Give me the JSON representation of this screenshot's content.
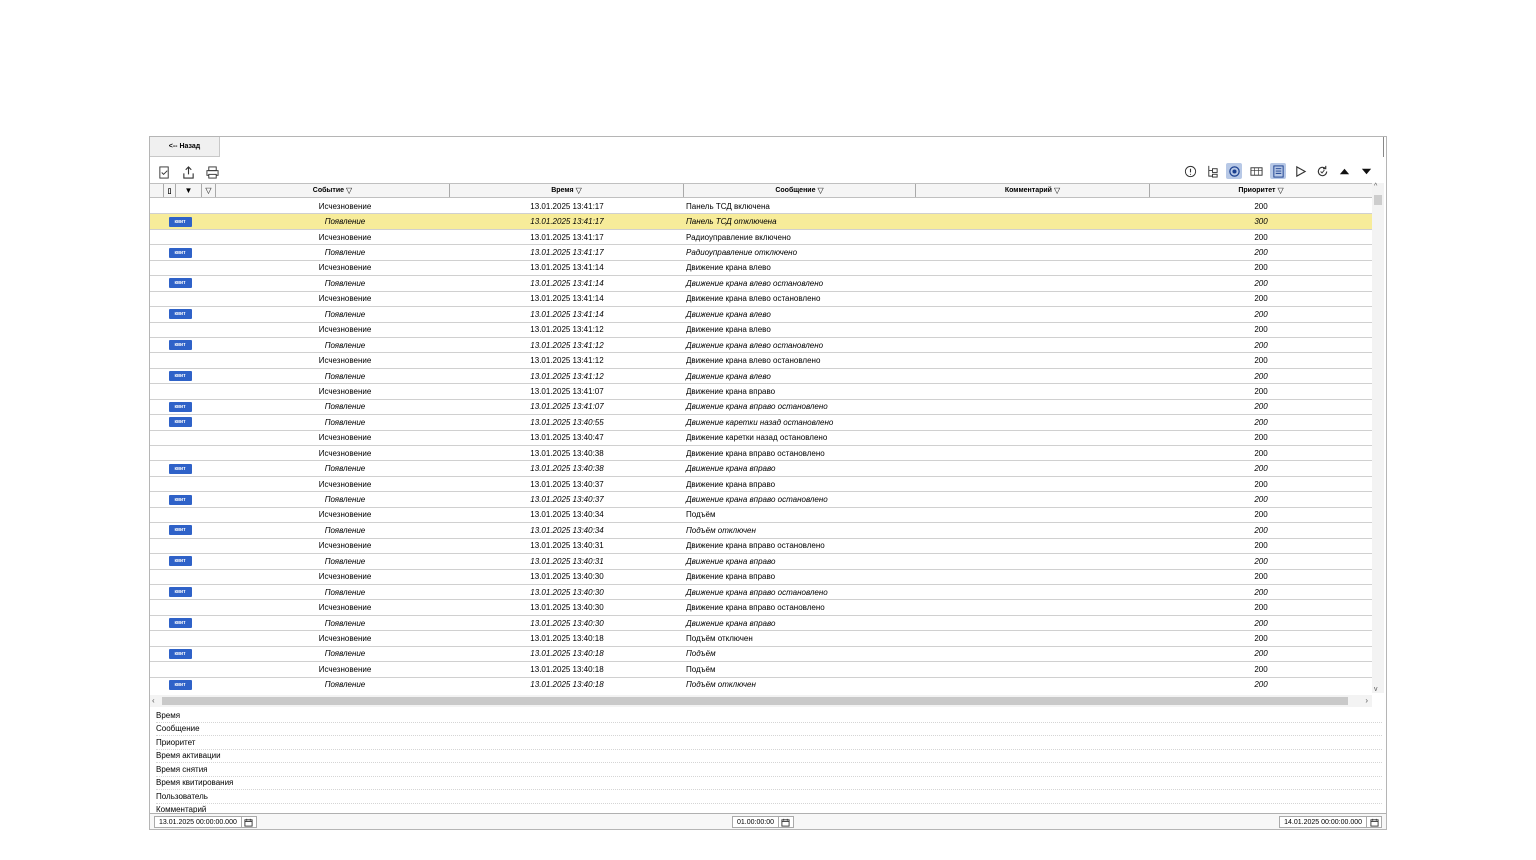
{
  "nav": {
    "back_label": "<-- Назад"
  },
  "toolbar_left": [
    "check-list-icon",
    "export-icon",
    "print-icon"
  ],
  "toolbar_right": [
    "info-icon",
    "tree-icon",
    "live-update-icon",
    "table-view-icon",
    "details-panel-icon",
    "play-icon",
    "refresh-icon",
    "arrow-up-icon",
    "arrow-down-icon"
  ],
  "columns": {
    "event": "Событие",
    "time": "Время",
    "message": "Сообщение",
    "comment": "Комментарий",
    "priority": "Приоритет"
  },
  "ack_label": "квит",
  "rows": [
    {
      "ack": false,
      "event": "Исчезновение",
      "time": "13.01.2025 13:41:17",
      "message": "Панель ТСД включена",
      "priority": "200"
    },
    {
      "ack": true,
      "hl": true,
      "event": "Появление",
      "time": "13.01.2025 13:41:17",
      "message": "Панель ТСД отключена",
      "priority": "300"
    },
    {
      "ack": false,
      "event": "Исчезновение",
      "time": "13.01.2025 13:41:17",
      "message": "Радиоуправление включено",
      "priority": "200"
    },
    {
      "ack": true,
      "event": "Появление",
      "time": "13.01.2025 13:41:17",
      "message": "Радиоуправление отключено",
      "priority": "200"
    },
    {
      "ack": false,
      "event": "Исчезновение",
      "time": "13.01.2025 13:41:14",
      "message": "Движение крана влево",
      "priority": "200"
    },
    {
      "ack": true,
      "event": "Появление",
      "time": "13.01.2025 13:41:14",
      "message": "Движение крана влево остановлено",
      "priority": "200"
    },
    {
      "ack": false,
      "event": "Исчезновение",
      "time": "13.01.2025 13:41:14",
      "message": "Движение крана влево остановлено",
      "priority": "200"
    },
    {
      "ack": true,
      "event": "Появление",
      "time": "13.01.2025 13:41:14",
      "message": "Движение крана влево",
      "priority": "200"
    },
    {
      "ack": false,
      "event": "Исчезновение",
      "time": "13.01.2025 13:41:12",
      "message": "Движение крана влево",
      "priority": "200"
    },
    {
      "ack": true,
      "event": "Появление",
      "time": "13.01.2025 13:41:12",
      "message": "Движение крана влево остановлено",
      "priority": "200"
    },
    {
      "ack": false,
      "event": "Исчезновение",
      "time": "13.01.2025 13:41:12",
      "message": "Движение крана влево остановлено",
      "priority": "200"
    },
    {
      "ack": true,
      "event": "Появление",
      "time": "13.01.2025 13:41:12",
      "message": "Движение крана влево",
      "priority": "200"
    },
    {
      "ack": false,
      "event": "Исчезновение",
      "time": "13.01.2025 13:41:07",
      "message": "Движение крана вправо",
      "priority": "200"
    },
    {
      "ack": true,
      "event": "Появление",
      "time": "13.01.2025 13:41:07",
      "message": "Движение крана вправо остановлено",
      "priority": "200"
    },
    {
      "ack": true,
      "event": "Появление",
      "time": "13.01.2025 13:40:55",
      "message": "Движение каретки назад остановлено",
      "priority": "200"
    },
    {
      "ack": false,
      "event": "Исчезновение",
      "time": "13.01.2025 13:40:47",
      "message": "Движение каретки назад остановлено",
      "priority": "200"
    },
    {
      "ack": false,
      "event": "Исчезновение",
      "time": "13.01.2025 13:40:38",
      "message": "Движение крана вправо остановлено",
      "priority": "200"
    },
    {
      "ack": true,
      "event": "Появление",
      "time": "13.01.2025 13:40:38",
      "message": "Движение крана вправо",
      "priority": "200"
    },
    {
      "ack": false,
      "event": "Исчезновение",
      "time": "13.01.2025 13:40:37",
      "message": "Движение крана вправо",
      "priority": "200"
    },
    {
      "ack": true,
      "event": "Появление",
      "time": "13.01.2025 13:40:37",
      "message": "Движение крана вправо остановлено",
      "priority": "200"
    },
    {
      "ack": false,
      "event": "Исчезновение",
      "time": "13.01.2025 13:40:34",
      "message": "Подъём",
      "priority": "200"
    },
    {
      "ack": true,
      "event": "Появление",
      "time": "13.01.2025 13:40:34",
      "message": "Подъём отключен",
      "priority": "200"
    },
    {
      "ack": false,
      "event": "Исчезновение",
      "time": "13.01.2025 13:40:31",
      "message": "Движение крана вправо остановлено",
      "priority": "200"
    },
    {
      "ack": true,
      "event": "Появление",
      "time": "13.01.2025 13:40:31",
      "message": "Движение крана вправо",
      "priority": "200"
    },
    {
      "ack": false,
      "event": "Исчезновение",
      "time": "13.01.2025 13:40:30",
      "message": "Движение крана вправо",
      "priority": "200"
    },
    {
      "ack": true,
      "event": "Появление",
      "time": "13.01.2025 13:40:30",
      "message": "Движение крана вправо остановлено",
      "priority": "200"
    },
    {
      "ack": false,
      "event": "Исчезновение",
      "time": "13.01.2025 13:40:30",
      "message": "Движение крана вправо остановлено",
      "priority": "200"
    },
    {
      "ack": true,
      "event": "Появление",
      "time": "13.01.2025 13:40:30",
      "message": "Движение крана вправо",
      "priority": "200"
    },
    {
      "ack": false,
      "event": "Исчезновение",
      "time": "13.01.2025 13:40:18",
      "message": "Подъём отключен",
      "priority": "200"
    },
    {
      "ack": true,
      "event": "Появление",
      "time": "13.01.2025 13:40:18",
      "message": "Подъём",
      "priority": "200"
    },
    {
      "ack": false,
      "event": "Исчезновение",
      "time": "13.01.2025 13:40:18",
      "message": "Подъём",
      "priority": "200"
    },
    {
      "ack": true,
      "event": "Появление",
      "time": "13.01.2025 13:40:18",
      "message": "Подъём отключен",
      "priority": "200"
    }
  ],
  "details": [
    "Время",
    "Сообщение",
    "Приоритет",
    "Время активации",
    "Время снятия",
    "Время квитирования",
    "Пользователь",
    "Комментарий"
  ],
  "footer": {
    "start": "13.01.2025 00:00:00.000",
    "interval": "01.00:00:00",
    "end": "14.01.2025 00:00:00.000"
  },
  "colors": {
    "highlight": "#f7ec9a",
    "ack_button": "#2f62c8"
  }
}
